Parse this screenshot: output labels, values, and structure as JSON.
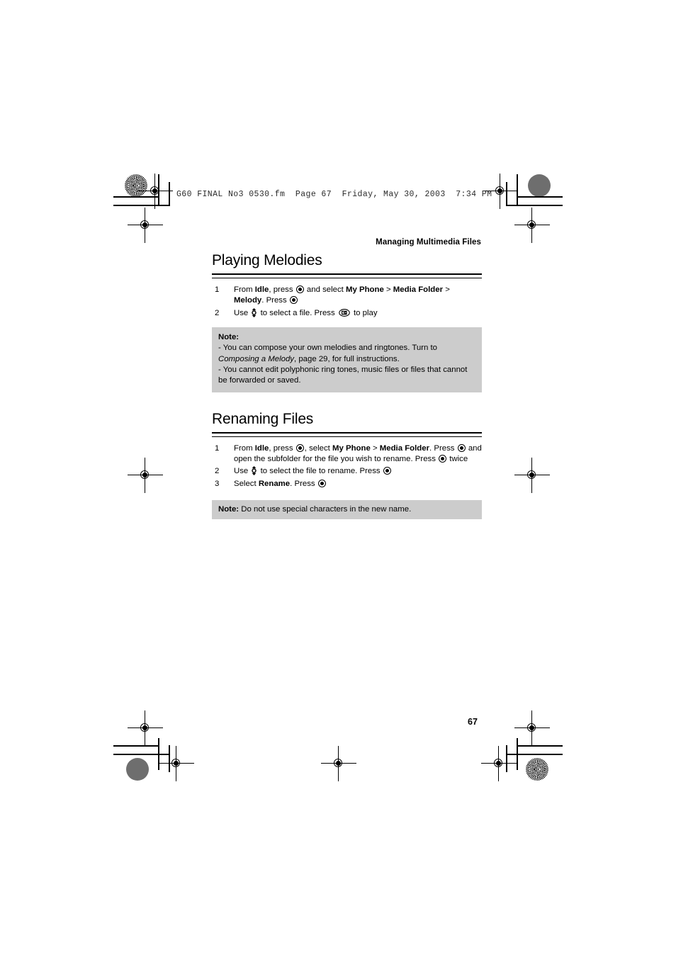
{
  "document": {
    "fm_header": "G60 FINAL No3 0530.fm  Page 67  Friday, May 30, 2003  7:34 PM",
    "running_head": "Managing Multimedia Files",
    "page_number": "67"
  },
  "sections": [
    {
      "title": "Playing Melodies",
      "steps": [
        {
          "num": "1",
          "parts": [
            {
              "t": "From "
            },
            {
              "t": "Idle",
              "b": true
            },
            {
              "t": ", press "
            },
            {
              "icon": "center-key-icon"
            },
            {
              "t": " and select "
            },
            {
              "t": "My Phone",
              "b": true
            },
            {
              "t": " > "
            },
            {
              "t": "Media Folder",
              "b": true
            },
            {
              "t": " > "
            },
            {
              "t": "Melody",
              "b": true
            },
            {
              "t": ". Press "
            },
            {
              "icon": "center-key-icon"
            }
          ]
        },
        {
          "num": "2",
          "parts": [
            {
              "t": "Use "
            },
            {
              "icon": "navigation-key-icon"
            },
            {
              "t": " to select a file. Press "
            },
            {
              "icon": "soft-key-icon"
            },
            {
              "t": " to play"
            }
          ]
        }
      ],
      "note": {
        "label": "Note:",
        "lines": [
          [
            {
              "t": "- You can compose your own melodies and ringtones. Turn to "
            },
            {
              "t": "Composing a Melody",
              "i": true
            },
            {
              "t": ", page 29, for full instructions."
            }
          ],
          [
            {
              "t": "- You cannot edit polyphonic ring tones, music files or files that cannot be forwarded or saved."
            }
          ]
        ]
      }
    },
    {
      "title": "Renaming Files",
      "steps": [
        {
          "num": "1",
          "parts": [
            {
              "t": "From "
            },
            {
              "t": "Idle",
              "b": true
            },
            {
              "t": ", press "
            },
            {
              "icon": "center-key-icon"
            },
            {
              "t": ", select "
            },
            {
              "t": "My Phone",
              "b": true
            },
            {
              "t": " > "
            },
            {
              "t": "Media Folder",
              "b": true
            },
            {
              "t": ". Press "
            },
            {
              "icon": "center-key-icon"
            },
            {
              "t": " and open the subfolder for the file you wish to rename. Press "
            },
            {
              "icon": "center-key-icon"
            },
            {
              "t": " twice"
            }
          ]
        },
        {
          "num": "2",
          "parts": [
            {
              "t": "Use "
            },
            {
              "icon": "navigation-key-icon"
            },
            {
              "t": " to select the file to rename. Press "
            },
            {
              "icon": "center-key-icon"
            }
          ]
        },
        {
          "num": "3",
          "parts": [
            {
              "t": "Select "
            },
            {
              "t": "Rename",
              "b": true
            },
            {
              "t": ". Press "
            },
            {
              "icon": "center-key-icon"
            }
          ]
        }
      ],
      "note": {
        "label": "Note:",
        "inline": true,
        "lines": [
          [
            {
              "t": " Do not use special characters in the new name."
            }
          ]
        ]
      }
    }
  ],
  "colors": {
    "note_background": "#cccccc",
    "text": "#000000",
    "page_background": "#ffffff"
  }
}
